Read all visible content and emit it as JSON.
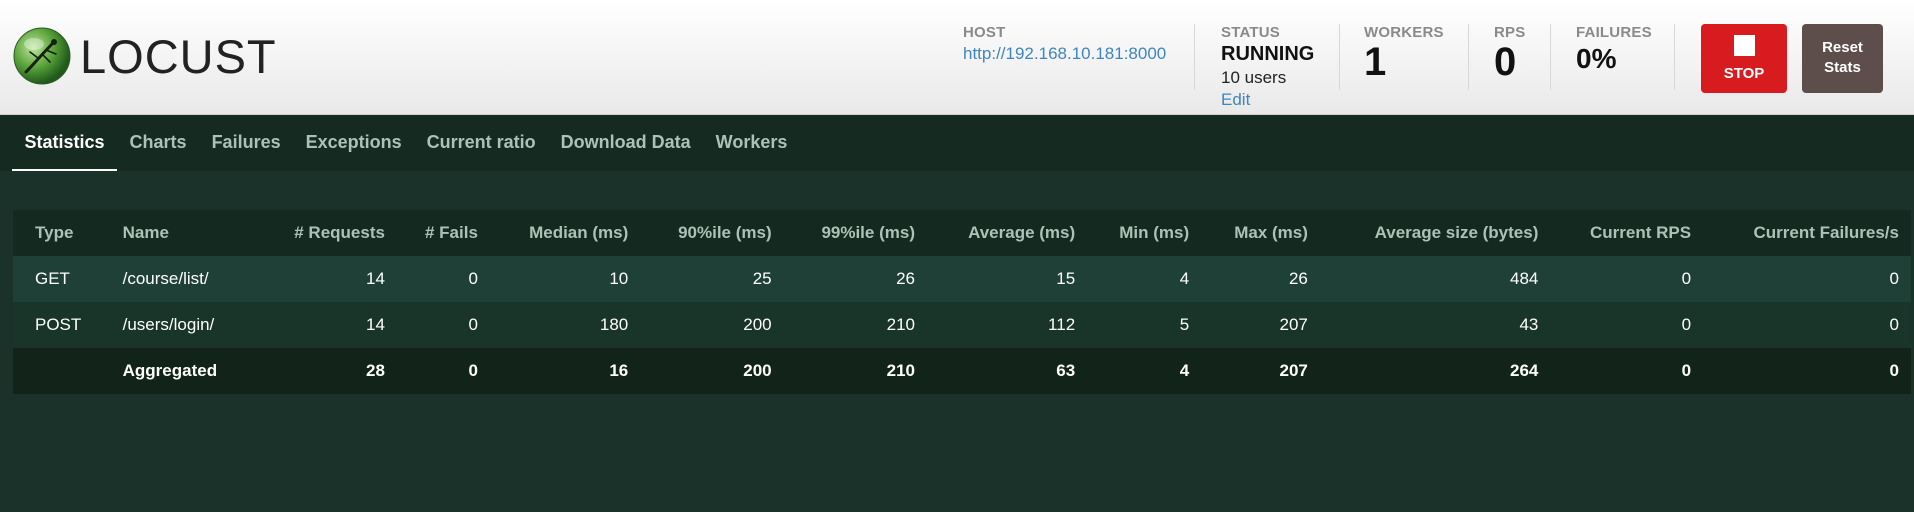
{
  "app": {
    "logo_text": "LOCUST"
  },
  "stats_header": {
    "host": {
      "label": "HOST",
      "value": "http://192.168.10.181:8000"
    },
    "status": {
      "label": "STATUS",
      "value": "RUNNING",
      "users": "10 users",
      "edit_label": "Edit"
    },
    "workers": {
      "label": "WORKERS",
      "value": "1"
    },
    "rps": {
      "label": "RPS",
      "value": "0"
    },
    "failures": {
      "label": "FAILURES",
      "value": "0%"
    }
  },
  "buttons": {
    "stop_label": "STOP",
    "reset_label_line1": "Reset",
    "reset_label_line2": "Stats"
  },
  "tabs": [
    {
      "label": "Statistics",
      "active": true
    },
    {
      "label": "Charts"
    },
    {
      "label": "Failures"
    },
    {
      "label": "Exceptions"
    },
    {
      "label": "Current ratio"
    },
    {
      "label": "Download Data"
    },
    {
      "label": "Workers"
    }
  ],
  "table": {
    "headers": [
      "Type",
      "Name",
      "# Requests",
      "# Fails",
      "Median (ms)",
      "90%ile (ms)",
      "99%ile (ms)",
      "Average (ms)",
      "Min (ms)",
      "Max (ms)",
      "Average size (bytes)",
      "Current RPS",
      "Current Failures/s"
    ],
    "rows": [
      [
        "GET",
        "/course/list/",
        "14",
        "0",
        "10",
        "25",
        "26",
        "15",
        "4",
        "26",
        "484",
        "0",
        "0"
      ],
      [
        "POST",
        "/users/login/",
        "14",
        "0",
        "180",
        "200",
        "210",
        "112",
        "5",
        "207",
        "43",
        "0",
        "0"
      ],
      [
        "",
        "Aggregated",
        "28",
        "0",
        "16",
        "200",
        "210",
        "63",
        "4",
        "207",
        "264",
        "0",
        "0"
      ]
    ]
  },
  "colors": {
    "accent_link": "#3e86c1",
    "stop_button": "#d81b1f",
    "reset_button": "#5d4e4c",
    "background": "#1a3229"
  }
}
